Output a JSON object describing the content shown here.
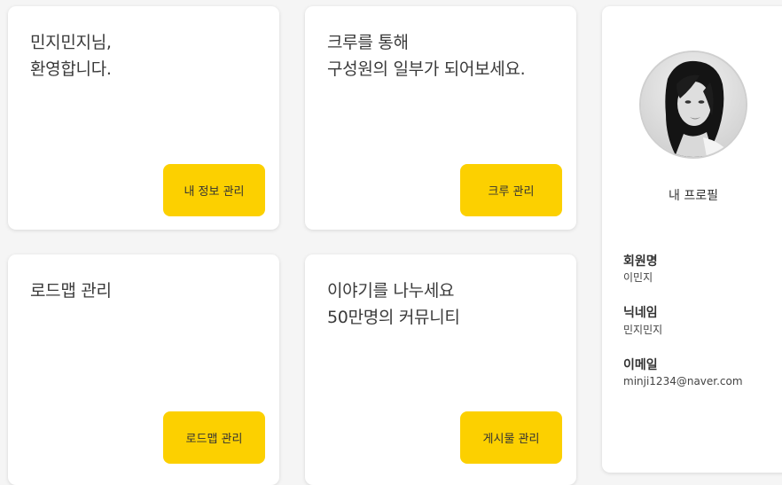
{
  "cards": [
    {
      "lines": [
        "민지민지님,",
        "환영합니다."
      ],
      "button_label": "내 정보 관리"
    },
    {
      "lines": [
        "크루를 통해",
        "구성원의 일부가 되어보세요."
      ],
      "button_label": "크루 관리"
    },
    {
      "lines": [
        "로드맵 관리"
      ],
      "button_label": "로드맵 관리"
    },
    {
      "lines": [
        "이야기를 나누세요",
        "50만명의 커뮤니티"
      ],
      "button_label": "게시물 관리"
    }
  ],
  "profile": {
    "title": "내 프로필",
    "fields": [
      {
        "label": "회원명",
        "value": "이민지"
      },
      {
        "label": "닉네임",
        "value": "민지민지"
      },
      {
        "label": "이메일",
        "value": "minji1234@naver.com"
      }
    ]
  },
  "colors": {
    "accent": "#fcd000",
    "background": "#f5f5f5",
    "card": "#ffffff"
  },
  "icons": {
    "avatar": "profile-photo"
  }
}
